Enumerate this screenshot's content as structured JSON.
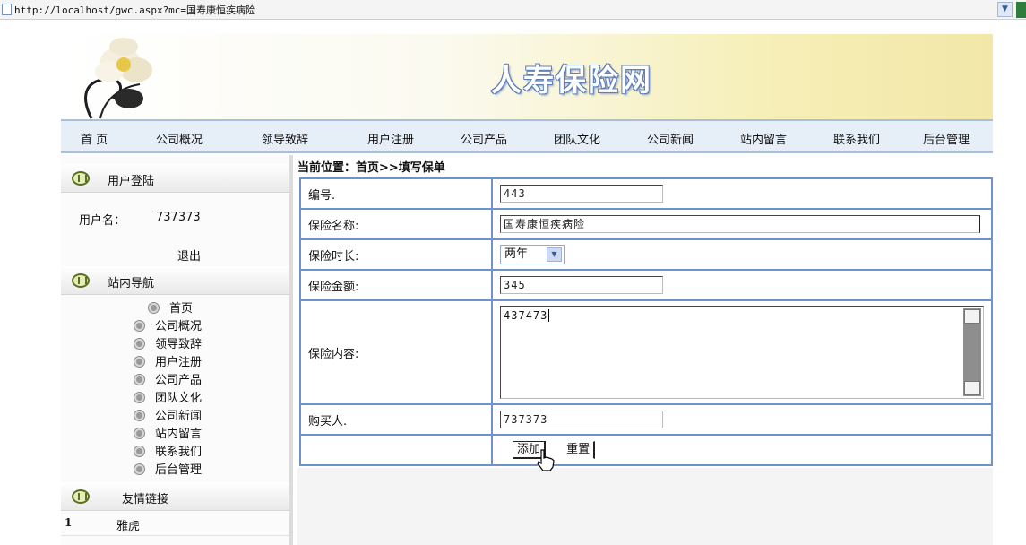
{
  "browser": {
    "url": "http://localhost/gwc.aspx?mc=国寿康恒疾病险"
  },
  "banner": {
    "title": "人寿保险网"
  },
  "nav": [
    "首 页",
    "公司概况",
    "领导致辞",
    "用户注册",
    "公司产品",
    "团队文化",
    "公司新闻",
    "站内留言",
    "联系我们",
    "后台管理"
  ],
  "login_box": {
    "title": "用户登陆",
    "username_label": "用户名：",
    "username": "737373",
    "logout": "退出"
  },
  "site_nav": {
    "title": "站内导航",
    "items": [
      "首页",
      "公司概况",
      "领导致辞",
      "用户注册",
      "公司产品",
      "团队文化",
      "公司新闻",
      "站内留言",
      "联系我们",
      "后台管理"
    ]
  },
  "links_box": {
    "title": "友情链接",
    "items": [
      {
        "num": "1",
        "text": "雅虎"
      }
    ]
  },
  "breadcrumb": "当前位置：首页>>填写保单",
  "form": {
    "id_label": "编号.",
    "id_value": "443",
    "name_label": "保险名称:",
    "name_value": "国寿康恒疾病险",
    "duration_label": "保险时长:",
    "duration_value": "两年",
    "amount_label": "保险金额:",
    "amount_value": "345",
    "content_label": "保险内容:",
    "content_value": "437473",
    "buyer_label": "购买人.",
    "buyer_value": "737373",
    "add_button": "添加",
    "reset_button": "重置"
  }
}
